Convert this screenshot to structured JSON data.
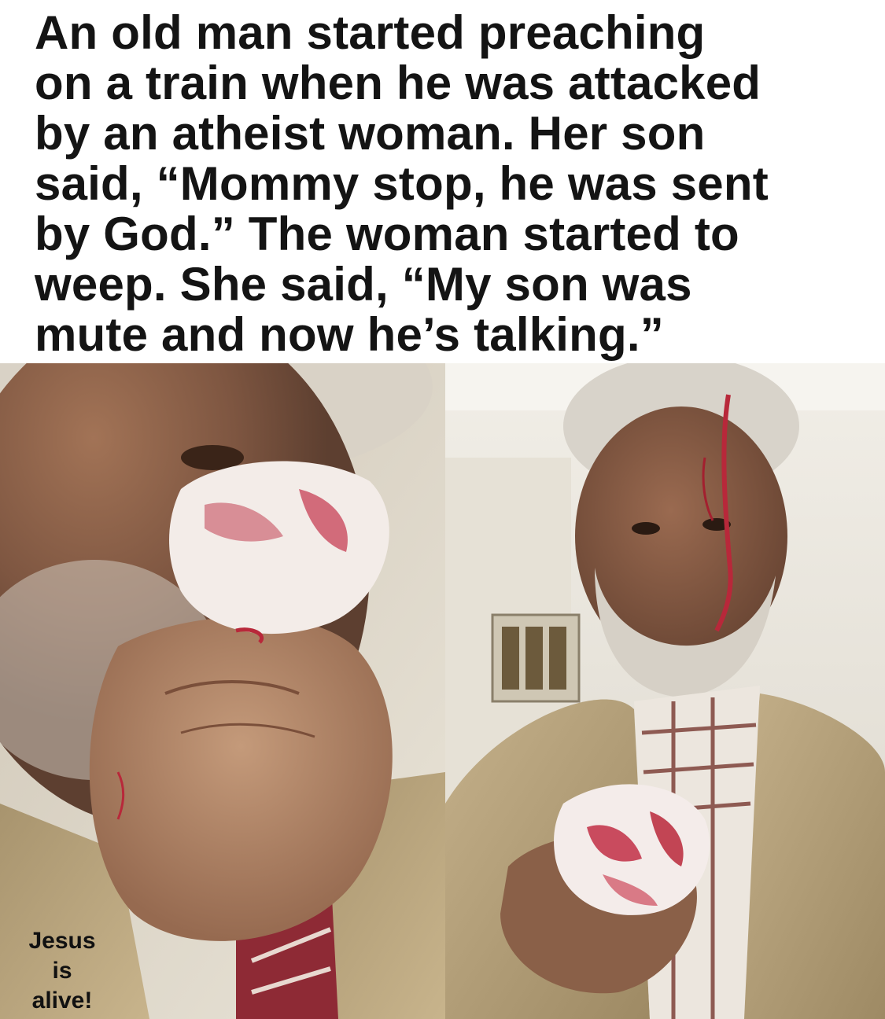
{
  "caption": {
    "lines": [
      "An old man started preaching",
      "on a train when he was attacked",
      "by an atheist woman. Her son",
      "said, “Mommy stop, he was sent",
      "by God.” The woman started to",
      "weep. She said, “My son was",
      "mute and now he’s talking.”"
    ]
  },
  "overlay": {
    "lines": [
      "Jesus",
      "is",
      "alive!"
    ]
  },
  "photos": {
    "left": "closeup-man-with-tissue-photo",
    "right": "man-with-bleeding-head-photo"
  },
  "colors": {
    "background": "#ffffff",
    "text": "#141414",
    "jacket": "#b4a07a",
    "skin": "#8a6048",
    "blood": "#b8283a",
    "train_wall": "#ece8df"
  }
}
